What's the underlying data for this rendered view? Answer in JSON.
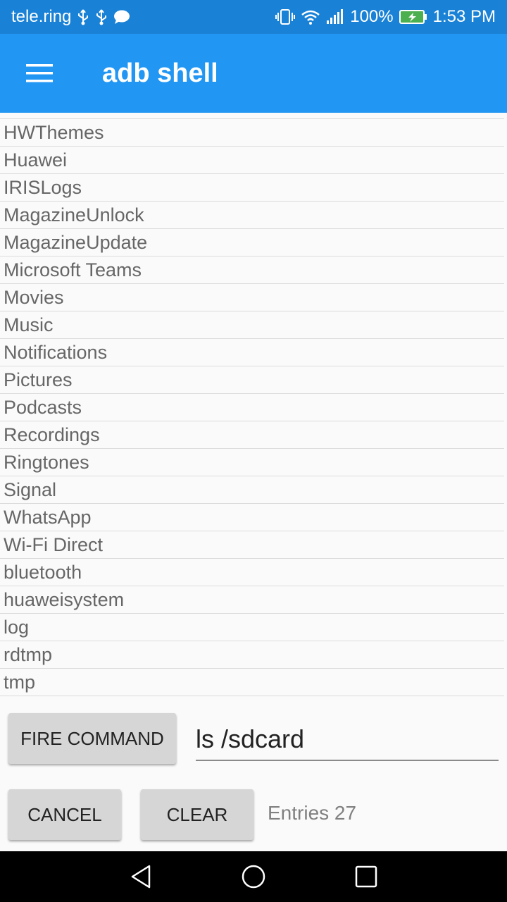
{
  "status_bar": {
    "carrier": "tele.ring",
    "battery_percent": "100%",
    "time": "1:53 PM",
    "icons": [
      "usb-icon",
      "usb-icon",
      "chat-bubble-icon",
      "vibrate-icon",
      "wifi-icon",
      "signal-icon",
      "battery-charging-icon"
    ]
  },
  "app_bar": {
    "title": "adb shell",
    "menu_icon": "hamburger-menu-icon"
  },
  "output": {
    "lines": [
      "HWThemes",
      "Huawei",
      "IRISLogs",
      "MagazineUnlock",
      "MagazineUpdate",
      "Microsoft Teams",
      "Movies",
      "Music",
      "Notifications",
      "Pictures",
      "Podcasts",
      "Recordings",
      "Ringtones",
      "Signal",
      "WhatsApp",
      "Wi-Fi Direct",
      "bluetooth",
      "huaweisystem",
      "log",
      "rdtmp",
      "tmp"
    ]
  },
  "controls": {
    "fire_label": "FIRE COMMAND",
    "command_value": "ls /sdcard",
    "cancel_label": "CANCEL",
    "clear_label": "CLEAR",
    "entries_text": "Entries 27"
  },
  "nav_bar": {
    "icons": [
      "back-triangle-icon",
      "home-circle-icon",
      "recents-square-icon"
    ]
  },
  "colors": {
    "status_bar": "#1a82d6",
    "app_bar": "#2196f3",
    "button": "#d6d6d6"
  }
}
